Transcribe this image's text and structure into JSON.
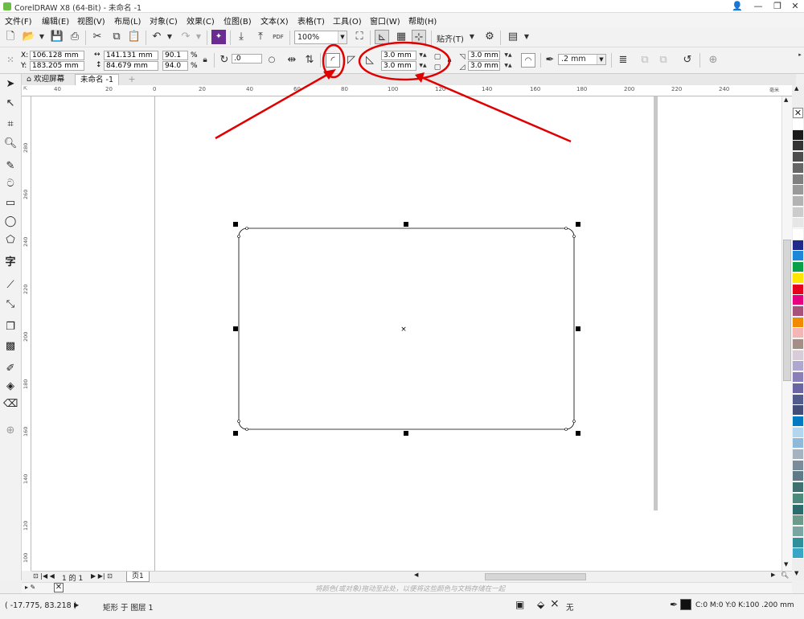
{
  "window": {
    "title": "CorelDRAW X8 (64-Bit) - 未命名 -1",
    "controls": [
      "👤",
      "—",
      "❐",
      "✕"
    ]
  },
  "menubar": {
    "items": [
      "文件(F)",
      "编辑(E)",
      "视图(V)",
      "布局(L)",
      "对象(C)",
      "效果(C)",
      "位图(B)",
      "文本(X)",
      "表格(T)",
      "工具(O)",
      "窗口(W)",
      "帮助(H)"
    ]
  },
  "toolbar": {
    "zoom": "100%",
    "snap_label": "贴齐(T)",
    "pdf_label": "PDF"
  },
  "property_bar": {
    "x_label": "X:",
    "y_label": "Y:",
    "x_value": "106.128 mm",
    "y_value": "183.205 mm",
    "width_value": "141.131 mm",
    "height_value": "84.679 mm",
    "scale_x": "90.1",
    "scale_y": "94.0",
    "percent": "%",
    "rotation": ".0",
    "corner_top_left": "3.0 mm",
    "corner_bottom_left": "3.0 mm",
    "corner_top_right": "3.0 mm",
    "corner_bottom_right": "3.0 mm",
    "outline_width": ".2 mm"
  },
  "tabs": {
    "welcome": "欢迎屏幕",
    "document": "未命名 -1"
  },
  "hruler": {
    "labels": [
      "40",
      "20",
      "0",
      "20",
      "40",
      "60",
      "80",
      "100",
      "120",
      "140",
      "160",
      "180",
      "200",
      "220",
      "240"
    ],
    "unit": "毫米"
  },
  "vruler": {
    "labels": [
      "280",
      "260",
      "240",
      "220",
      "200",
      "180",
      "160",
      "140",
      "120",
      "100"
    ]
  },
  "page_nav": {
    "page_of": "1 的 1",
    "page_tab": "页1"
  },
  "doc_palette": {
    "hint": "将颜色(或对象)拖动至此处，以便将这些颜色与文档存储在一起"
  },
  "status": {
    "cursor": "( -17.775, 83.218 )",
    "object_info": "矩形 于 图层 1",
    "fill_none": "无",
    "outline_info": "C:0 M:0 Y:0 K:100  .200 mm"
  },
  "palette_colors": [
    "#ffffff",
    "#1a1a1a",
    "#333333",
    "#4d4d4d",
    "#666666",
    "#808080",
    "#999999",
    "#b3b3b3",
    "#cccccc",
    "#e6e6e6",
    "#ffffff",
    "#1f2a8a",
    "#1e88d8",
    "#0aa04a",
    "#ffe600",
    "#e6001e",
    "#e4007f",
    "#a8527b",
    "#f08a00",
    "#f4b6b4",
    "#a38f86",
    "#d7ccd8",
    "#b0a7cf",
    "#8b7fb9",
    "#6a66a3",
    "#515c8c",
    "#434e78",
    "#007ac0",
    "#b3d6ef",
    "#8fb9d9",
    "#a5b2bf",
    "#7a8b99",
    "#5e7a86",
    "#3e7070",
    "#4d8a7d",
    "#2c6c6c",
    "#6c9b8c",
    "#79a6a0",
    "#2f8f9a",
    "#3aa6c5"
  ]
}
